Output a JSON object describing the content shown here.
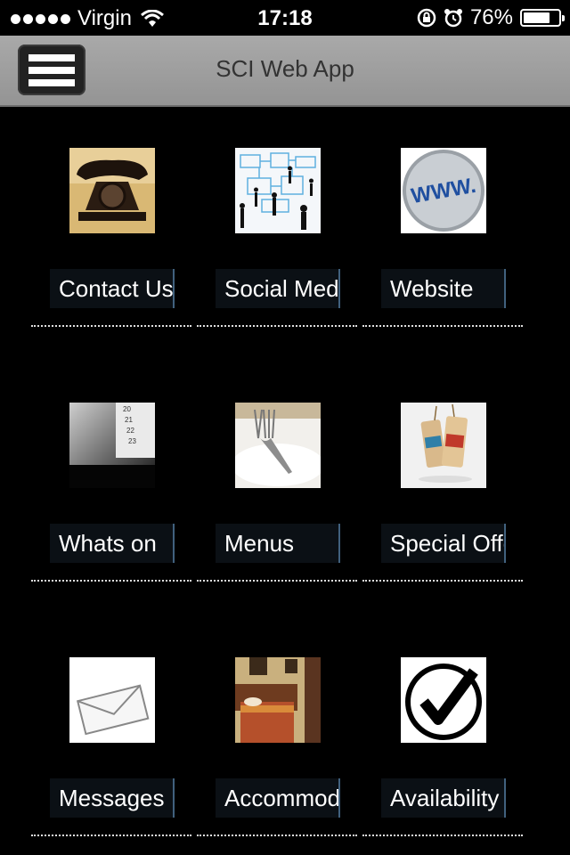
{
  "status_bar": {
    "carrier": "Virgin",
    "time": "17:18",
    "battery_percent": "76%",
    "battery_level": 0.76,
    "icons": [
      "signal-dots-icon",
      "wifi-icon",
      "rotation-lock-icon",
      "alarm-icon",
      "battery-icon"
    ]
  },
  "header": {
    "title": "SCI Web App",
    "menu_icon": "hamburger-menu-icon"
  },
  "tiles": [
    {
      "label": "Contact Us",
      "image": "vintage-telephone-image"
    },
    {
      "label": "Social Media",
      "image": "social-network-image"
    },
    {
      "label": "Website",
      "image": "www-button-image"
    },
    {
      "label": "Whats on",
      "image": "calendar-image"
    },
    {
      "label": "Menus",
      "image": "fork-plate-image"
    },
    {
      "label": "Special Offers",
      "image": "special-offer-tags-image"
    },
    {
      "label": "Messages",
      "image": "envelope-image"
    },
    {
      "label": "Accommodation",
      "image": "hotel-bedroom-image"
    },
    {
      "label": "Availability",
      "image": "checkmark-image"
    }
  ]
}
